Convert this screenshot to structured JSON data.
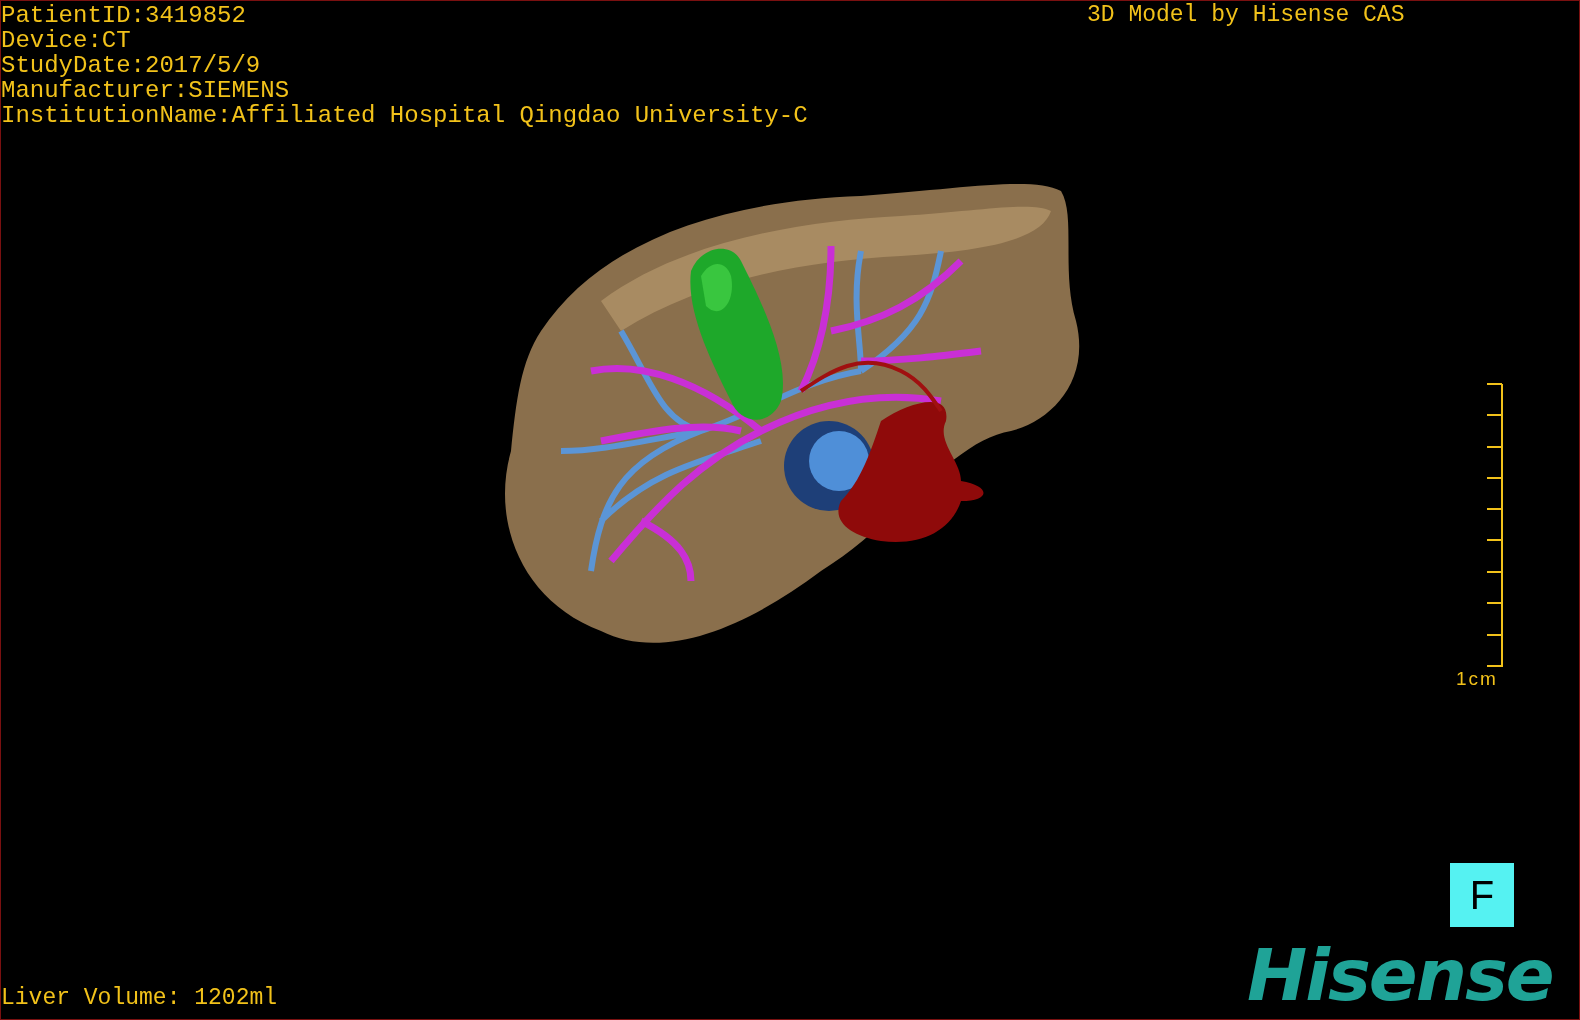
{
  "study_info": [
    "PatientID:3419852",
    "Device:CT",
    "StudyDate:2017/5/9",
    "Manufacturer:SIEMENS",
    "InstitutionName:Affiliated Hospital Qingdao University-C"
  ],
  "caption": "3D Model by Hisense CAS",
  "scale_bar": {
    "label": "1cm"
  },
  "view_button": {
    "label": "F"
  },
  "logo": "Hisense",
  "liver_volume": "Liver Volume: 1202ml"
}
